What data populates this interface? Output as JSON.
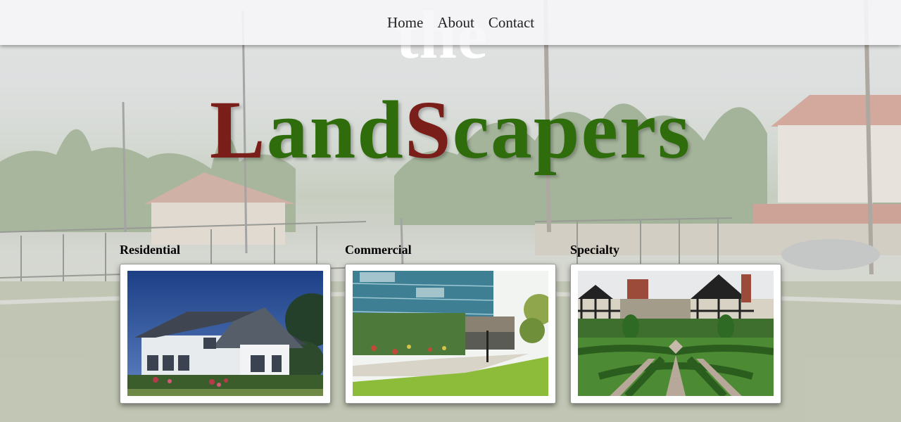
{
  "nav": {
    "items": [
      {
        "label": "Home"
      },
      {
        "label": "About"
      },
      {
        "label": "Contact"
      }
    ]
  },
  "title": {
    "prefix": "the",
    "parts": [
      {
        "text": "L",
        "color": "#7a1e1a"
      },
      {
        "text": "and",
        "color": "#2e6c0c"
      },
      {
        "text": "S",
        "color": "#7a1e1a"
      },
      {
        "text": "capers",
        "color": "#2e6c0c"
      }
    ]
  },
  "services": [
    {
      "heading": "Residential",
      "image": "house-photo"
    },
    {
      "heading": "Commercial",
      "image": "office-building-photo"
    },
    {
      "heading": "Specialty",
      "image": "formal-garden-photo"
    }
  ]
}
